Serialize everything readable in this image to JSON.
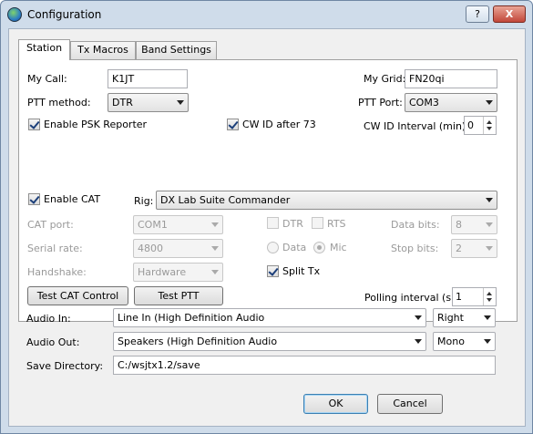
{
  "window": {
    "title": "Configuration",
    "help_label": "?",
    "close_label": "X"
  },
  "tabs": [
    {
      "label": "Station"
    },
    {
      "label": "Tx Macros"
    },
    {
      "label": "Band Settings"
    }
  ],
  "station": {
    "my_call_label": "My Call:",
    "my_call_value": "K1JT",
    "my_grid_label": "My Grid:",
    "my_grid_value": "FN20qi",
    "ptt_method_label": "PTT method:",
    "ptt_method_value": "DTR",
    "ptt_port_label": "PTT Port:",
    "ptt_port_value": "COM3",
    "psk_label": "Enable PSK Reporter",
    "psk_checked": true,
    "cwid_label": "CW ID after 73",
    "cwid_checked": true,
    "cw_interval_label": "CW ID Interval (min):",
    "cw_interval_value": "0",
    "enable_cat_label": "Enable CAT",
    "enable_cat_checked": true,
    "rig_label": "Rig:",
    "rig_value": "DX Lab Suite Commander",
    "cat_port_label": "CAT port:",
    "cat_port_value": "COM1",
    "serial_rate_label": "Serial rate:",
    "serial_rate_value": "4800",
    "handshake_label": "Handshake:",
    "handshake_value": "Hardware",
    "dtr_label": "DTR",
    "rts_label": "RTS",
    "data_label": "Data",
    "mic_label": "Mic",
    "split_label": "Split Tx",
    "split_checked": true,
    "data_bits_label": "Data bits:",
    "data_bits_value": "8",
    "stop_bits_label": "Stop bits:",
    "stop_bits_value": "2",
    "test_cat_label": "Test CAT Control",
    "test_ptt_label": "Test PTT",
    "polling_label": "Polling interval (s):",
    "polling_value": "1"
  },
  "audio": {
    "in_label": "Audio In:",
    "in_value": "Line In (High Definition Audio",
    "in_channel": "Right",
    "out_label": "Audio Out:",
    "out_value": "Speakers (High Definition Audio",
    "out_channel": "Mono",
    "save_dir_label": "Save Directory:",
    "save_dir_value": "C:/wsjtx1.2/save"
  },
  "buttons": {
    "ok": "OK",
    "cancel": "Cancel"
  }
}
